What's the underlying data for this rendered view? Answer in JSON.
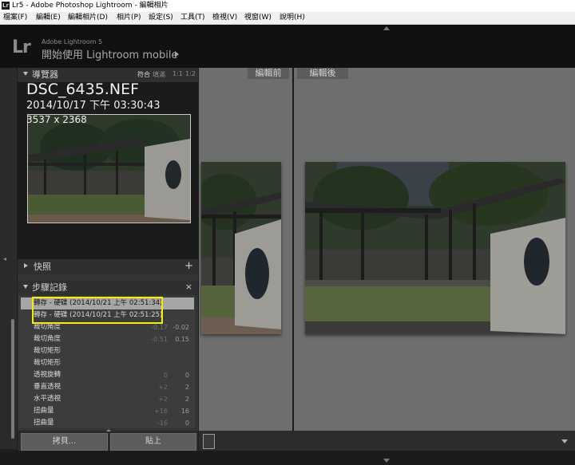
{
  "window": {
    "app_icon": "Lr",
    "title": "Lr5 - Adobe Photoshop Lightroom - 編輯相片"
  },
  "menu": [
    "檔案(F)",
    "編輯(E)",
    "編輯相片(D)",
    "相片(P)",
    "設定(S)",
    "工具(T)",
    "檢視(V)",
    "視窗(W)",
    "說明(H)"
  ],
  "identity": {
    "logo": "Lr",
    "product": "Adobe Lightroom 5",
    "tagline": "開始使用 Lightroom mobile"
  },
  "navigator": {
    "title": "導覽器",
    "zoom_options": [
      "符合",
      "填滿",
      "1:1",
      "1:2"
    ],
    "filename": "DSC_6435.NEF",
    "capture_date": "2014/10/17 下午 03:30:43",
    "dimensions": "3537 x 2368"
  },
  "snapshots": {
    "title": "快照",
    "add_icon": "plus-icon"
  },
  "history": {
    "title": "步驟記錄",
    "close_icon": "close-icon",
    "items": [
      {
        "label": "轉存 - 硬碟 (2014/10/21 上午 02:51:34)",
        "v1": "",
        "v2": "",
        "selected": true
      },
      {
        "label": "轉存 - 硬碟 (2014/10/21 上午 02:51:25)",
        "v1": "",
        "v2": "",
        "selected": false
      },
      {
        "label": "裁切角度",
        "v1": "-0.17",
        "v2": "-0.02",
        "selected": false
      },
      {
        "label": "裁切角度",
        "v1": "-0.51",
        "v2": "0.15",
        "selected": false
      },
      {
        "label": "裁切矩形",
        "v1": "",
        "v2": "",
        "selected": false
      },
      {
        "label": "裁切矩形",
        "v1": "",
        "v2": "",
        "selected": false
      },
      {
        "label": "透視旋轉",
        "v1": "0",
        "v2": "0",
        "selected": false
      },
      {
        "label": "垂直透視",
        "v1": "+2",
        "v2": "2",
        "selected": false
      },
      {
        "label": "水平透視",
        "v1": "+2",
        "v2": "2",
        "selected": false
      },
      {
        "label": "扭曲量",
        "v1": "+16",
        "v2": "16",
        "selected": false
      },
      {
        "label": "扭曲量",
        "v1": "-16",
        "v2": "0",
        "selected": false
      }
    ]
  },
  "buttons": {
    "copy": "拷貝...",
    "paste": "貼上"
  },
  "views": {
    "before": "編輯前",
    "after": "編輯後"
  },
  "colors": {
    "highlight": "#f2ef00",
    "panel": "#343434",
    "canvas": "#6e6e6e"
  }
}
